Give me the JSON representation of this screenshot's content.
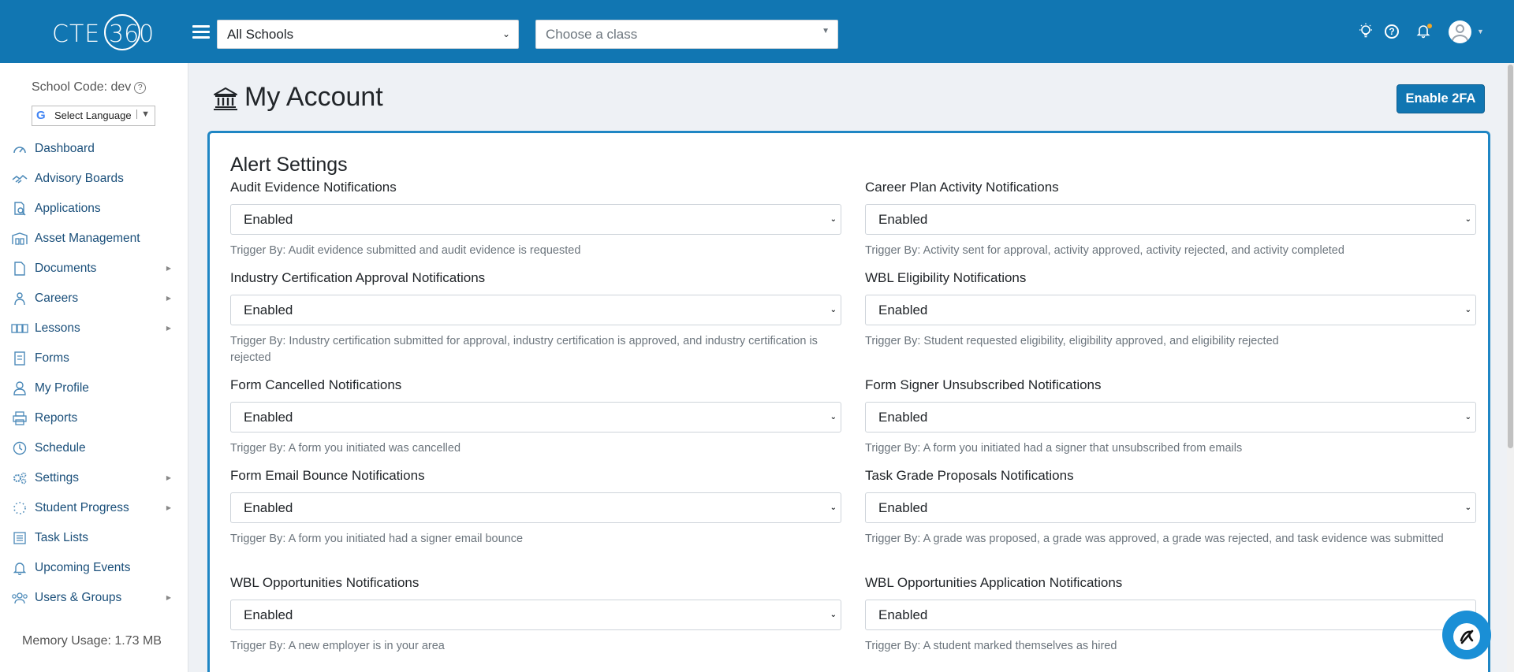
{
  "header": {
    "logo_text": "CTE",
    "logo_ring_text": "360",
    "schools_select": "All Schools",
    "class_select_placeholder": "Choose a class"
  },
  "sidebar": {
    "school_code": "School Code: dev",
    "language_label": "Select Language",
    "items": [
      {
        "label": "Dashboard",
        "icon": "gauge-icon",
        "has_submenu": false
      },
      {
        "label": "Advisory Boards",
        "icon": "handshake-icon",
        "has_submenu": false
      },
      {
        "label": "Applications",
        "icon": "document-search-icon",
        "has_submenu": false
      },
      {
        "label": "Asset Management",
        "icon": "warehouse-icon",
        "has_submenu": false
      },
      {
        "label": "Documents",
        "icon": "file-icon",
        "has_submenu": true
      },
      {
        "label": "Careers",
        "icon": "people-icon",
        "has_submenu": true
      },
      {
        "label": "Lessons",
        "icon": "lessons-icon",
        "has_submenu": true
      },
      {
        "label": "Forms",
        "icon": "form-icon",
        "has_submenu": false
      },
      {
        "label": "My Profile",
        "icon": "user-icon",
        "has_submenu": false
      },
      {
        "label": "Reports",
        "icon": "printer-icon",
        "has_submenu": false
      },
      {
        "label": "Schedule",
        "icon": "clock-icon",
        "has_submenu": false
      },
      {
        "label": "Settings",
        "icon": "gears-icon",
        "has_submenu": true
      },
      {
        "label": "Student Progress",
        "icon": "spinner-icon",
        "has_submenu": true
      },
      {
        "label": "Task Lists",
        "icon": "list-icon",
        "has_submenu": false
      },
      {
        "label": "Upcoming Events",
        "icon": "bell-icon",
        "has_submenu": false
      },
      {
        "label": "Users & Groups",
        "icon": "users-icon",
        "has_submenu": true
      }
    ],
    "memory_usage": "Memory Usage: 1.73 MB"
  },
  "main": {
    "page_title": "My Account",
    "enable_2fa_label": "Enable 2FA",
    "card_title": "Alert Settings",
    "fields": [
      {
        "label": "Audit Evidence Notifications",
        "value": "Enabled",
        "hint": "Trigger By: Audit evidence submitted and audit evidence is requested"
      },
      {
        "label": "Career Plan Activity Notifications",
        "value": "Enabled",
        "hint": "Trigger By: Activity sent for approval, activity approved, activity rejected, and activity completed"
      },
      {
        "label": "Industry Certification Approval Notifications",
        "value": "Enabled",
        "hint": "Trigger By: Industry certification submitted for approval, industry certification is approved, and industry certification is rejected"
      },
      {
        "label": "WBL Eligibility Notifications",
        "value": "Enabled",
        "hint": "Trigger By: Student requested eligibility, eligibility approved, and eligibility rejected"
      },
      {
        "label": "Form Cancelled Notifications",
        "value": "Enabled",
        "hint": "Trigger By: A form you initiated was cancelled"
      },
      {
        "label": "Form Signer Unsubscribed Notifications",
        "value": "Enabled",
        "hint": "Trigger By: A form you initiated had a signer that unsubscribed from emails"
      },
      {
        "label": "Form Email Bounce Notifications",
        "value": "Enabled",
        "hint": "Trigger By: A form you initiated had a signer email bounce"
      },
      {
        "label": "Task Grade Proposals Notifications",
        "value": "Enabled",
        "hint": "Trigger By: A grade was proposed, a grade was approved, a grade was rejected, and task evidence was submitted"
      },
      {
        "label": "WBL Opportunities Notifications",
        "value": "Enabled",
        "hint": "Trigger By: A new employer is in your area"
      },
      {
        "label": "WBL Opportunities Application Notifications",
        "value": "Enabled",
        "hint": "Trigger By: A student marked themselves as hired"
      }
    ]
  },
  "colors": {
    "brand_blue": "#1176b2",
    "card_border": "#1f86c4",
    "nav_text": "#1a4f7a"
  }
}
